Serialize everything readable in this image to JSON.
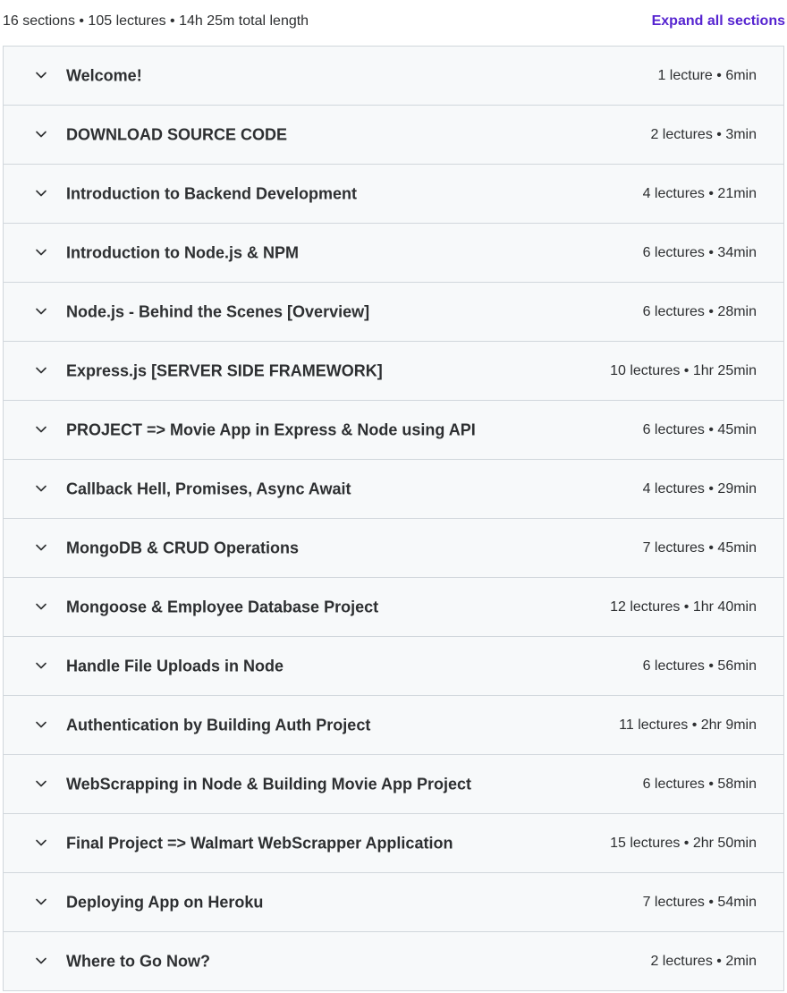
{
  "summary": {
    "text": "16 sections • 105 lectures • 14h 25m total length",
    "expand_label": "Expand all sections"
  },
  "colors": {
    "accent": "#5624d0",
    "row_background": "#f7f9fa",
    "border": "#d1d7dc",
    "text": "#2d2f31"
  },
  "sections": [
    {
      "title": "Welcome!",
      "meta": "1 lecture • 6min",
      "icon": "chevron-down-icon"
    },
    {
      "title": "DOWNLOAD SOURCE CODE",
      "meta": "2 lectures • 3min",
      "icon": "chevron-down-icon"
    },
    {
      "title": "Introduction to Backend Development",
      "meta": "4 lectures • 21min",
      "icon": "chevron-down-icon"
    },
    {
      "title": "Introduction to Node.js & NPM",
      "meta": "6 lectures • 34min",
      "icon": "chevron-down-icon"
    },
    {
      "title": "Node.js - Behind the Scenes [Overview]",
      "meta": "6 lectures • 28min",
      "icon": "chevron-down-icon"
    },
    {
      "title": "Express.js [SERVER SIDE FRAMEWORK]",
      "meta": "10 lectures • 1hr 25min",
      "icon": "chevron-down-icon"
    },
    {
      "title": "PROJECT => Movie App in Express & Node using API",
      "meta": "6 lectures • 45min",
      "icon": "chevron-down-icon"
    },
    {
      "title": "Callback Hell, Promises, Async Await",
      "meta": "4 lectures • 29min",
      "icon": "chevron-down-icon"
    },
    {
      "title": "MongoDB & CRUD Operations",
      "meta": "7 lectures • 45min",
      "icon": "chevron-down-icon"
    },
    {
      "title": "Mongoose & Employee Database Project",
      "meta": "12 lectures • 1hr 40min",
      "icon": "chevron-down-icon"
    },
    {
      "title": "Handle File Uploads in Node",
      "meta": "6 lectures • 56min",
      "icon": "chevron-down-icon"
    },
    {
      "title": "Authentication by Building Auth Project",
      "meta": "11 lectures • 2hr 9min",
      "icon": "chevron-down-icon"
    },
    {
      "title": "WebScrapping in Node & Building Movie App Project",
      "meta": "6 lectures • 58min",
      "icon": "chevron-down-icon"
    },
    {
      "title": "Final Project => Walmart WebScrapper Application",
      "meta": "15 lectures • 2hr 50min",
      "icon": "chevron-down-icon"
    },
    {
      "title": "Deploying App on Heroku",
      "meta": "7 lectures • 54min",
      "icon": "chevron-down-icon"
    },
    {
      "title": "Where to Go Now?",
      "meta": "2 lectures • 2min",
      "icon": "chevron-down-icon"
    }
  ]
}
